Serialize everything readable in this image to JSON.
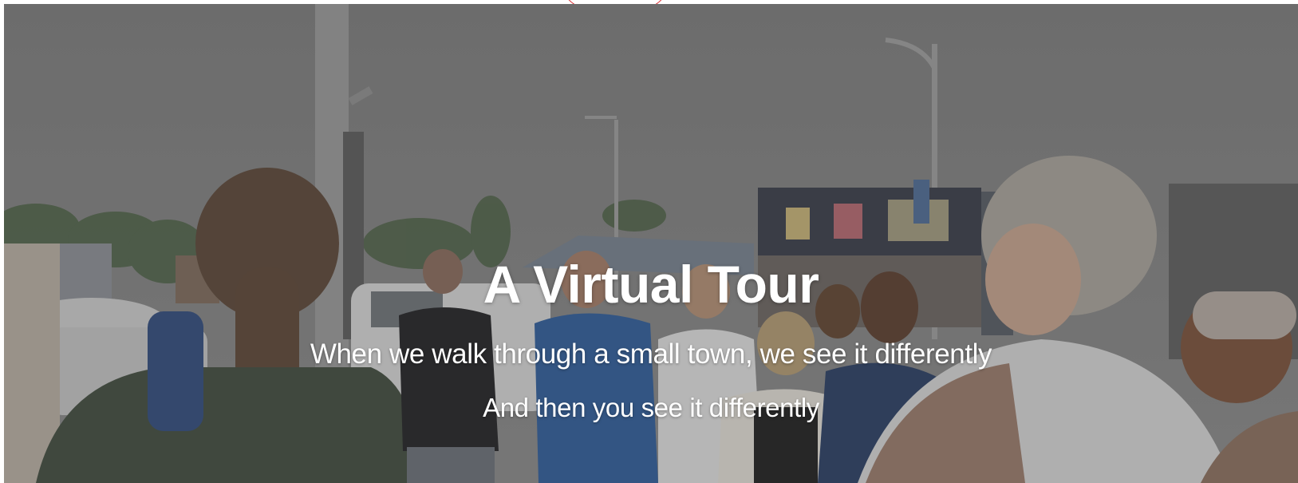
{
  "hero": {
    "title": "A Virtual Tour",
    "subtitle": "When we walk through a small town, we see it differently",
    "tagline": "And then you see it differently"
  },
  "colors": {
    "overlay": "#6f6f6f",
    "text": "#ffffff",
    "marker": "#d9262c"
  }
}
